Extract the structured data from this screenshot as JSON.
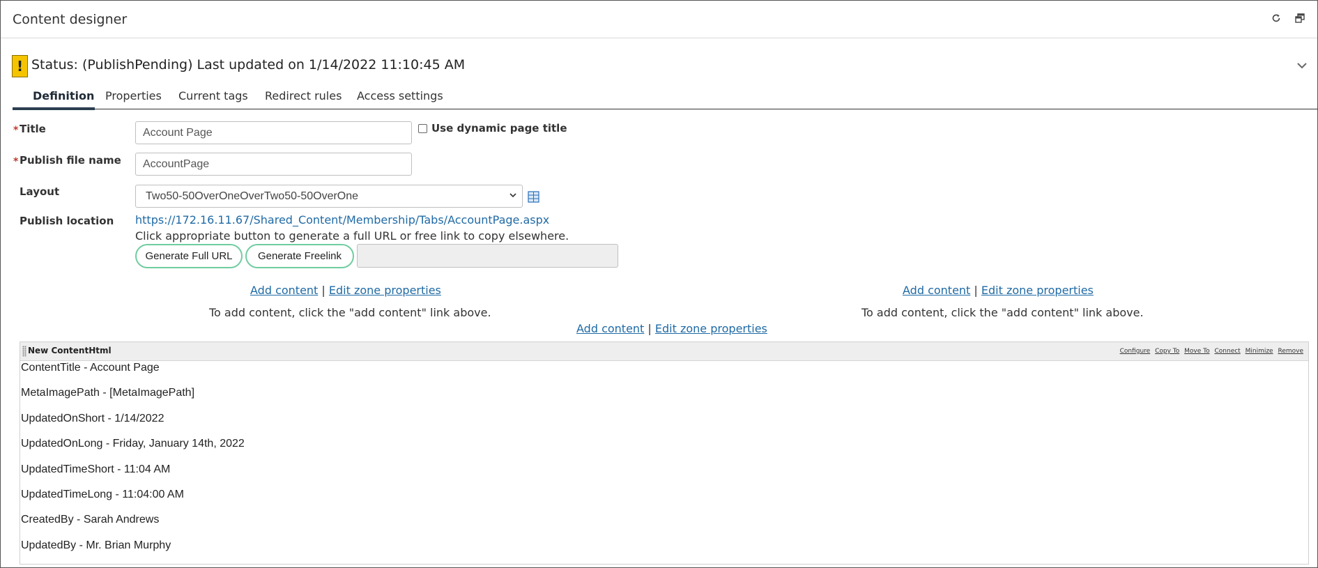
{
  "header": {
    "title": "Content designer",
    "icons": [
      "refresh-icon",
      "popout-icon"
    ]
  },
  "status": {
    "text": "Status: (PublishPending) Last updated on 1/14/2022 11:10:45 AM",
    "badge": "!",
    "badge_color": "#f5c400"
  },
  "tabs": [
    {
      "label": "Definition",
      "active": true
    },
    {
      "label": "Properties"
    },
    {
      "label": "Current tags"
    },
    {
      "label": "Redirect rules"
    },
    {
      "label": "Access settings"
    }
  ],
  "form": {
    "title_label": "Title",
    "title_value": "Account Page",
    "dynamic_title_label": "Use dynamic page title",
    "dynamic_title_checked": false,
    "publish_file_label": "Publish file name",
    "publish_file_value": "AccountPage",
    "layout_label": "Layout",
    "layout_value": "Two50-50OverOneOverTwo50-50OverOne",
    "publish_location_label": "Publish location",
    "publish_url": "https://172.16.11.67/Shared_Content/Membership/Tabs/AccountPage.aspx",
    "help_text": "Click appropriate button to generate a full URL or free link to copy elsewhere.",
    "generate_full_url": "Generate Full URL",
    "generate_freelink": "Generate Freelink",
    "generated_link_value": ""
  },
  "zones": {
    "add_content": "Add content",
    "separator": "|",
    "edit_zone": "Edit zone properties",
    "hint": "To add content, click the \"add content\" link above."
  },
  "content_item": {
    "name": "New ContentHtml",
    "actions": [
      "Configure",
      "Copy To",
      "Move To",
      "Connect",
      "Minimize",
      "Remove"
    ],
    "lines": [
      "ContentTitle - Account Page",
      "MetaImagePath - [MetaImagePath]",
      "UpdatedOnShort - 1/14/2022",
      "UpdatedOnLong - Friday, January 14th, 2022",
      "UpdatedTimeShort - 11:04 AM",
      "UpdatedTimeLong - 11:04:00 AM",
      "CreatedBy - Sarah Andrews",
      "UpdatedBy - Mr. Brian Murphy"
    ]
  },
  "colors": {
    "link": "#1f6aa5",
    "pill_border": "#6fcca0",
    "required": "#c0392b",
    "tab_underline": "#2c3e50"
  }
}
